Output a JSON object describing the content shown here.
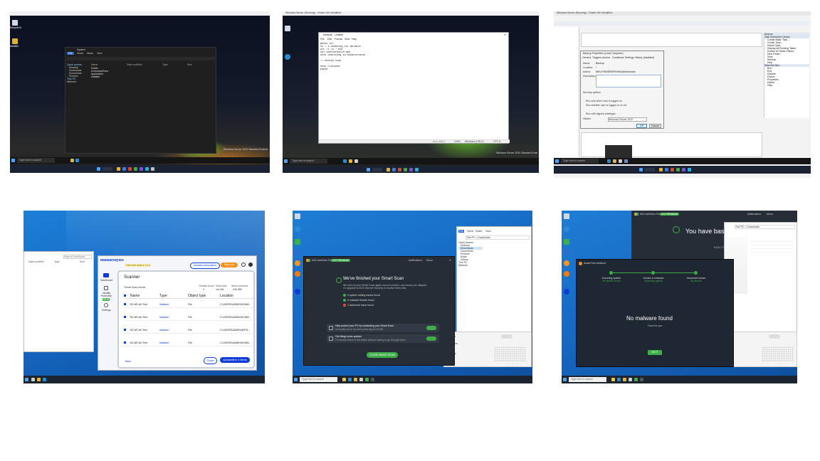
{
  "panels": {
    "p1": {
      "window_title": "System",
      "tabs": [
        "File",
        "Home",
        "Share",
        "View"
      ],
      "sidebar": [
        "Quick access",
        "Desktop",
        "Downloads",
        "Documents",
        "Pictures",
        "This PC",
        "Network"
      ],
      "headers": [
        "Name",
        "Date modified",
        "Type",
        "Size"
      ],
      "rows": [
        "Folder",
        "Download/Area",
        "Application",
        "Installer"
      ],
      "desktop_icons": [
        "Recycle Bin",
        "Installer"
      ],
      "watermark": "Windows Server 2022 Standard Evaluation",
      "taskbar_search": "Type here to search"
    },
    "p2": {
      "vm_title": "Windows Server (Running) - Oracle VM VirtualBox",
      "window_title": "Notepad - Untitled",
      "menu": [
        "File",
        "Edit",
        "Format",
        "View",
        "Help"
      ],
      "lines": [
        "@echo off",
        "cd / # Scanning for malware",
        "dir /s /b *.exe",
        "set searchPath=%~dp0",
        "echo Searching in %searchPath%",
        "",
        "// Nested scan",
        "",
        "echo Finished",
        "pause"
      ],
      "status": [
        "Ln 1, Col 1",
        "100%",
        "Windows (CRLF)",
        "UTF-8"
      ],
      "taskbar_search": "Type here to search",
      "watermark": "Windows Server 2022 Standard Evaluation"
    },
    "p3": {
      "vm_title": "Windows Server (Running) - Oracle VM VirtualBox",
      "dialog_title": "Backup Properties (Local Computer)",
      "dialog_tabs": [
        "General",
        "Triggers",
        "Actions",
        "Conditions",
        "Settings",
        "History (disabled)"
      ],
      "fields": [
        {
          "label": "Name:",
          "value": "Backup"
        },
        {
          "label": "Location:",
          "value": "\\"
        },
        {
          "label": "Author:",
          "value": "WIN-FHE4SRMFKNH\\Administrator"
        },
        {
          "label": "Description:",
          "value": ""
        }
      ],
      "security": "Security options",
      "options": [
        "Run only when user is logged on",
        "Run whether user is logged on or not",
        "Run with highest privileges",
        "Hidden"
      ],
      "configure_for": "Windows Server 2022",
      "buttons": [
        "OK",
        "Cancel"
      ],
      "actions_title": "Actions",
      "actions": [
        "Task Scheduler Library",
        "Create Basic Task...",
        "Create Task...",
        "Import Task...",
        "Display All Running Tasks",
        "Enable All Tasks History",
        "New Folder...",
        "View",
        "Refresh",
        "Help",
        "Selected Item",
        "Run",
        "End",
        "Disable",
        "Export...",
        "Properties",
        "Delete",
        "Help"
      ],
      "taskbar_search": "Type here to search"
    },
    "p4": {
      "brand": "Malwarebytes",
      "trial_badge": "Free trial ends in 14 days",
      "activate": "Activate subscription",
      "buy": "Buy now",
      "nav": [
        "Dashboard",
        "Identity Protection",
        "Settings"
      ],
      "nav_badge": "NEW",
      "heading": "Scanner",
      "section": "Threat Scan results",
      "stats": [
        {
          "label": "Threats found",
          "value": "4"
        },
        {
          "label": "Scan time",
          "value": "1m 15s"
        },
        {
          "label": "Items scanned",
          "value": "244,059"
        }
      ],
      "columns": [
        "Name",
        "Type",
        "Object type",
        "Location"
      ],
      "results": [
        {
          "name": "EICAR-AV-Test",
          "type": "Malware",
          "object": "File",
          "location": "C:\\USERS\\ADMIN\\DOWN..."
        },
        {
          "name": "EICAR-AV-Test",
          "type": "Malware",
          "object": "File",
          "location": "C:\\USERS\\ADMIN\\DOWN..."
        },
        {
          "name": "EICAR-AV-Test",
          "type": "Malware",
          "object": "File",
          "location": "C:\\USERS\\ADMIN\\APPD..."
        },
        {
          "name": "EICAR-AV-Test",
          "type": "Malware",
          "object": "File",
          "location": "C:\\USERS\\ADMIN\\DOWN..."
        }
      ],
      "back": "Back",
      "close": "Close",
      "quarantine": "Quarantine 4 items",
      "bg_window": {
        "search": "Search Downloads",
        "cols": [
          "Date modified",
          "Type",
          "Size"
        ]
      }
    },
    "p5": {
      "app": "AVG AntiVirus Free",
      "badge": "GO PREMIUM",
      "header_links": [
        "Notifications",
        "Menu"
      ],
      "title": "We've finished your Smart Scan",
      "subtitle": "We were in your Smart Scan again soon to monitor, any issues you skipped.",
      "upgrade": "Or upgrade to AVG Internet Security to resolve them now.",
      "results": [
        "0 system setting issues found",
        "0 malware threats found",
        "1 advanced issue found"
      ],
      "options": [
        {
          "title": "Help protect your PC by scheduling your Smart Scan",
          "desc": "Currently set to run every first day at 10 AM."
        },
        {
          "title": "Get things done quicker",
          "desc": "Fix issues found in the future without having to go through them."
        }
      ],
      "close": "CLOSE SMART SCAN",
      "explorer_tabs": [
        "File",
        "Home",
        "Share",
        "View"
      ],
      "explorer_path": "This PC > Downloads",
      "explorer_items": [
        "Quick access",
        "Desktop",
        "Downloads",
        "Documents",
        "Pictures",
        "Music",
        "Videos",
        "This PC",
        "Network"
      ],
      "side_text": [
        "Upgrade",
        "Protection",
        "Features"
      ],
      "taskbar_search": "Type here to search"
    },
    "p6": {
      "app": "AVG AntiVirus Free",
      "badge": "GO PREMIUM",
      "header_links": [
        "Notifications",
        "Menu"
      ],
      "hero": "You have basic p",
      "protection_labels": [
        "BASIC PROTECTION",
        "FULL P"
      ],
      "dialog_title": "Avast Free Antivirus",
      "steps": [
        {
          "label": "Scanning system",
          "status": "No issues found"
        },
        {
          "label": "Viruses & malware",
          "status": "Scanning queue"
        },
        {
          "label": "Advanced issues",
          "status": "No issues"
        }
      ],
      "result": "No malware found",
      "result_sub": "Good for you",
      "next": "NEXT",
      "explorer_path": "This PC > Downloads",
      "taskbar_search": "Type here to search"
    }
  },
  "colors": {
    "win_blue": "#0f5fb8",
    "avg_green": "#3fae49",
    "mb_blue": "#0d3bd8",
    "mb_orange": "#f7941d",
    "dark_panel": "#1e2530"
  }
}
